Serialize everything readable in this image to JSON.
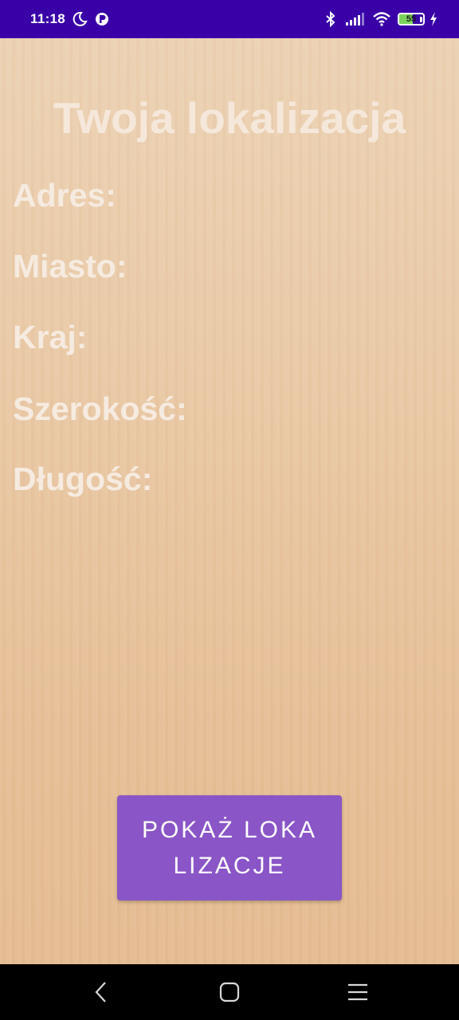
{
  "status_bar": {
    "time": "11:18",
    "battery_level": "55",
    "battery_fraction": 0.55,
    "icons": [
      "moon-icon",
      "app-notification-icon",
      "bluetooth-icon",
      "signal-icon",
      "wifi-icon",
      "battery-icon",
      "charging-icon"
    ]
  },
  "page": {
    "title": "Twoja lokalizacja",
    "labels": {
      "address": "Adres:",
      "city": "Miasto:",
      "country": "Kraj:",
      "latitude": "Szerokość:",
      "longitude": "Długość:"
    },
    "show_location_button": "POKAŻ LOKALIZACJE"
  },
  "colors": {
    "status_bar": "#3a00a8",
    "background": "#e8c6a0",
    "text": "#f6ebe0",
    "button": "#8a55c6"
  },
  "nav_bar": {
    "icons": [
      "back-icon",
      "home-icon",
      "menu-icon"
    ]
  }
}
